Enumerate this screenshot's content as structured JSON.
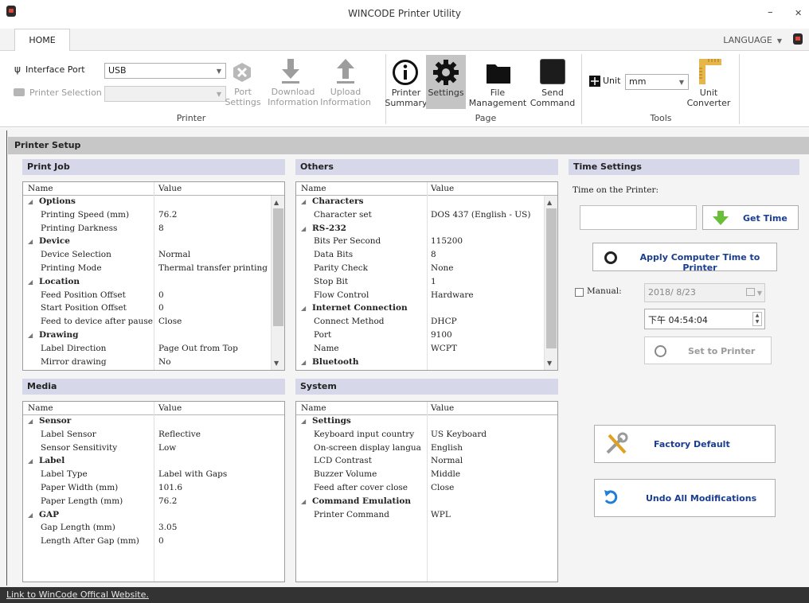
{
  "window": {
    "title": "WINCODE Printer Utility",
    "minimize": "–",
    "close": "✕"
  },
  "tabs": {
    "home": "HOME",
    "language": "LANGUAGE"
  },
  "ribbon": {
    "printer_group": {
      "label": "Printer",
      "interface_port_label": "Interface Port",
      "interface_port_value": "USB",
      "printer_selection_label": "Printer Selection",
      "port_settings": [
        "Port",
        "Settings"
      ],
      "download_information": [
        "Download",
        "Information"
      ],
      "upload_information": [
        "Upload",
        "Information"
      ]
    },
    "page_group": {
      "label": "Page",
      "printer_summary": [
        "Printer",
        "Summary"
      ],
      "settings": "Settings",
      "file_management": [
        "File",
        "Management"
      ],
      "send_command": [
        "Send",
        "Command"
      ]
    },
    "tools_group": {
      "label": "Tools",
      "unit_label": "Unit",
      "unit_value": "mm",
      "unit_converter": [
        "Unit",
        "Converter"
      ]
    }
  },
  "printer_setup": {
    "title": "Printer Setup",
    "columns": {
      "name": "Name",
      "value": "Value"
    },
    "print_job": {
      "title": "Print Job",
      "rows": [
        {
          "type": "cat",
          "name": "Options"
        },
        {
          "type": "item",
          "name": "Printing Speed (mm)",
          "value": "76.2"
        },
        {
          "type": "item",
          "name": "Printing Darkness",
          "value": "8"
        },
        {
          "type": "cat",
          "name": "Device"
        },
        {
          "type": "item",
          "name": "Device Selection",
          "value": "Normal"
        },
        {
          "type": "item",
          "name": "Printing Mode",
          "value": "Thermal transfer printing"
        },
        {
          "type": "cat",
          "name": "Location"
        },
        {
          "type": "item",
          "name": "Feed Position Offset",
          "value": "0"
        },
        {
          "type": "item",
          "name": "Start Position Offset",
          "value": "0"
        },
        {
          "type": "item",
          "name": "Feed to device after pause",
          "value": "Close"
        },
        {
          "type": "cat",
          "name": "Drawing"
        },
        {
          "type": "item",
          "name": "Label Direction",
          "value": "Page Out from Top"
        },
        {
          "type": "item",
          "name": "Mirror drawing",
          "value": "No"
        }
      ]
    },
    "media": {
      "title": "Media",
      "rows": [
        {
          "type": "cat",
          "name": "Sensor"
        },
        {
          "type": "item",
          "name": "Label Sensor",
          "value": "Reflective"
        },
        {
          "type": "item",
          "name": "Sensor Sensitivity",
          "value": "Low"
        },
        {
          "type": "cat",
          "name": "Label"
        },
        {
          "type": "item",
          "name": "Label Type",
          "value": "Label with Gaps"
        },
        {
          "type": "item",
          "name": "Paper Width (mm)",
          "value": "101.6"
        },
        {
          "type": "item",
          "name": "Paper Length (mm)",
          "value": "76.2"
        },
        {
          "type": "cat",
          "name": "GAP"
        },
        {
          "type": "item",
          "name": "Gap Length (mm)",
          "value": "3.05"
        },
        {
          "type": "item",
          "name": "Length After Gap (mm)",
          "value": "0"
        }
      ]
    },
    "others": {
      "title": "Others",
      "rows": [
        {
          "type": "cat",
          "name": "Characters"
        },
        {
          "type": "item",
          "name": "Character set",
          "value": "DOS 437 (English - US)"
        },
        {
          "type": "cat",
          "name": "RS-232"
        },
        {
          "type": "item",
          "name": "Bits Per Second",
          "value": "115200"
        },
        {
          "type": "item",
          "name": "Data Bits",
          "value": "8"
        },
        {
          "type": "item",
          "name": "Parity Check",
          "value": "None"
        },
        {
          "type": "item",
          "name": "Stop Bit",
          "value": "1"
        },
        {
          "type": "item",
          "name": "Flow Control",
          "value": "Hardware"
        },
        {
          "type": "cat",
          "name": "Internet Connection"
        },
        {
          "type": "item",
          "name": "Connect Method",
          "value": "DHCP"
        },
        {
          "type": "item",
          "name": "Port",
          "value": "9100"
        },
        {
          "type": "item",
          "name": "Name",
          "value": "WCPT"
        },
        {
          "type": "cat",
          "name": "Bluetooth"
        }
      ]
    },
    "system": {
      "title": "System",
      "rows": [
        {
          "type": "cat",
          "name": "Settings"
        },
        {
          "type": "item",
          "name": "Keyboard input country",
          "value": "US Keyboard"
        },
        {
          "type": "item",
          "name": "On-screen display langua",
          "value": "English"
        },
        {
          "type": "item",
          "name": "LCD Contrast",
          "value": "Normal"
        },
        {
          "type": "item",
          "name": "Buzzer Volume",
          "value": "Middle"
        },
        {
          "type": "item",
          "name": "Feed after cover close",
          "value": "Close"
        },
        {
          "type": "cat",
          "name": "Command Emulation"
        },
        {
          "type": "item",
          "name": "Printer Command",
          "value": "WPL"
        }
      ]
    }
  },
  "time_settings": {
    "title": "Time Settings",
    "time_on_printer_label": "Time on the Printer:",
    "get_time": "Get Time",
    "apply_computer_time": "Apply Computer Time to Printer",
    "manual_label": "Manual:",
    "date_value": "2018/ 8/23",
    "time_value": "下午 04:54:04",
    "set_to_printer": "Set to Printer"
  },
  "actions": {
    "factory_default": "Factory Default",
    "undo_all": "Undo All Modifications"
  },
  "status": {
    "link": "Link to WinCode Offical Website."
  },
  "colors": {
    "panel_header": "#d6d8ea",
    "button_text": "#1a3d8f",
    "get_time_arrow": "#6abf3a"
  }
}
